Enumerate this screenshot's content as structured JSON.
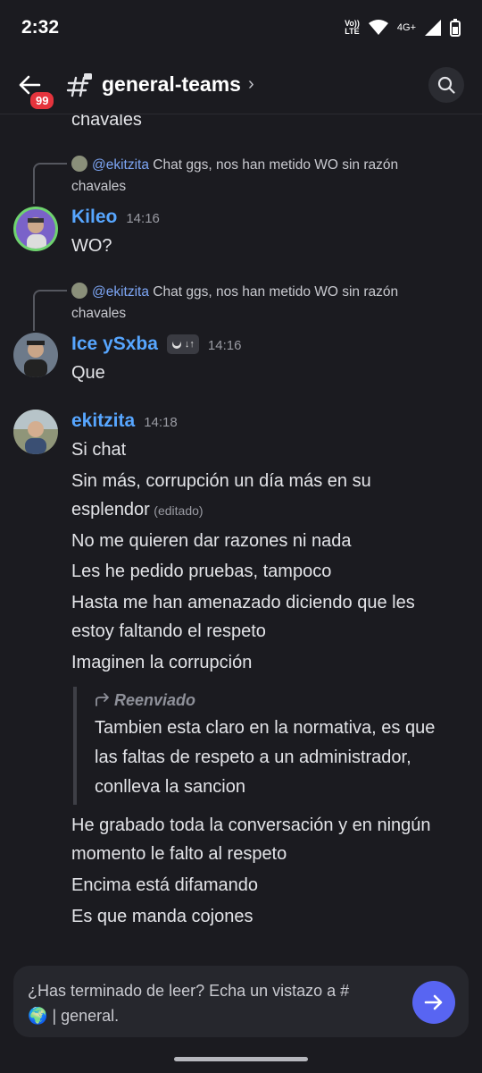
{
  "status_bar": {
    "time": "2:32",
    "volte_top": "Vo))",
    "volte_bottom": "LTE",
    "network": "4G+"
  },
  "header": {
    "unread_badge": "99",
    "channel_name": "general-teams",
    "chevron": "›"
  },
  "messages": {
    "top_fragment": "chavales",
    "reply1": {
      "mention": "@ekitzita",
      "text": "Chat ggs, nos han metido WO sin razón",
      "text2": "chavales"
    },
    "kileo": {
      "author": "Kileo",
      "time": "14:16",
      "body": "WO?"
    },
    "reply2": {
      "mention": "@ekitzita",
      "text": "Chat ggs, nos han metido WO sin razón",
      "text2": "chavales"
    },
    "ice": {
      "author": "Ice ySxba",
      "time": "14:16",
      "tag": "↓↑",
      "body": "Que"
    },
    "ekitzita": {
      "author": "ekitzita",
      "time": "14:18",
      "lines": [
        "Si chat",
        "Sin más, corrupción un día más en su",
        "esplendor",
        "No me quieren dar razones ni nada",
        "Les he pedido pruebas, tampoco",
        "Hasta me han amenazado diciendo que les",
        "estoy faltando el respeto",
        "Imaginen la corrupción"
      ],
      "edited": "(editado)",
      "forward": {
        "label": "Reenviado",
        "lines": [
          "Tambien esta claro en la normativa, es que",
          "las faltas de respeto a un administrador,",
          "conlleva la sancion"
        ]
      },
      "after_lines": [
        "He grabado toda la conversación y en ningún",
        "momento le falto al respeto",
        "Encima está difamando",
        "Es que manda cojones"
      ]
    }
  },
  "composer": {
    "prompt_line1": "¿Has terminado de leer? Echa un vistazo a #",
    "prompt_emoji": "🌍",
    "prompt_line2": "| general."
  },
  "colors": {
    "background": "#1b1b20",
    "username": "#57a6ff",
    "accent": "#5865f2",
    "badge": "#e5343d"
  }
}
